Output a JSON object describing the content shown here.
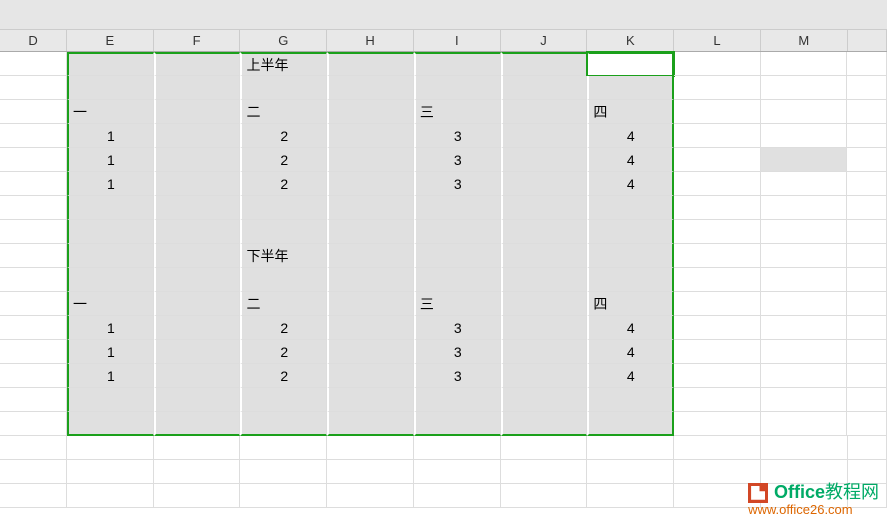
{
  "columns": [
    "D",
    "E",
    "F",
    "G",
    "H",
    "I",
    "J",
    "K",
    "L",
    "M"
  ],
  "selection": {
    "range": "E1:K16",
    "active_cell": "K1",
    "fill_color": "#e0e0e0",
    "border_color": "#1ba01b"
  },
  "extra_highlight": "M5",
  "cells": {
    "G1": "上半年",
    "E3": "一",
    "G3": "二",
    "I3": "三",
    "K3": "四",
    "E4": "1",
    "G4": "2",
    "I4": "3",
    "K4": "4",
    "E5": "1",
    "G5": "2",
    "I5": "3",
    "K5": "4",
    "E6": "1",
    "G6": "2",
    "I6": "3",
    "K6": "4",
    "G9": "下半年",
    "E11": "一",
    "G11": "二",
    "I11": "三",
    "K11": "四",
    "E12": "1",
    "G12": "2",
    "I12": "3",
    "K12": "4",
    "E13": "1",
    "G13": "2",
    "I13": "3",
    "K13": "4",
    "E14": "1",
    "G14": "2",
    "I14": "3",
    "K14": "4"
  },
  "watermark": {
    "line1_a": "Office",
    "line1_b": "教程网",
    "line2": "www.office26.com"
  }
}
